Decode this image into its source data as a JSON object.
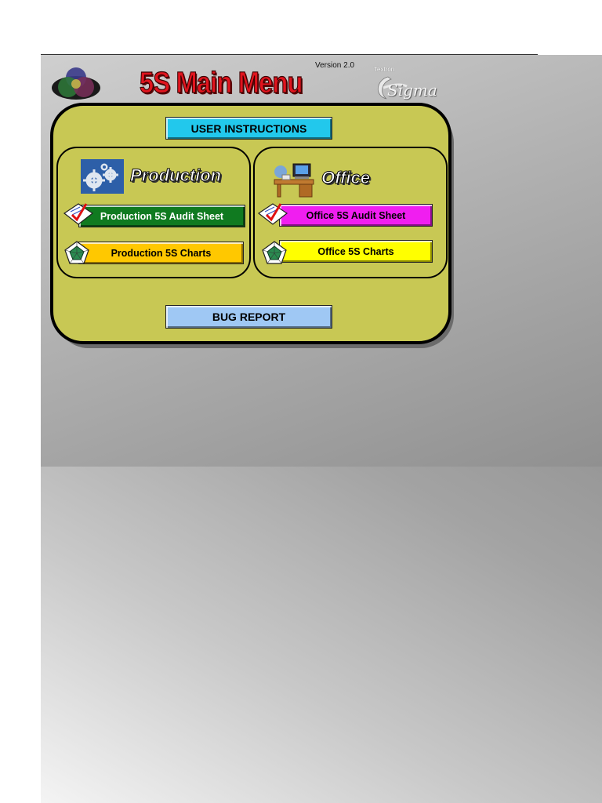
{
  "header": {
    "title": "5S Main Menu",
    "version": "Version 2.0",
    "brand_small": "Textron",
    "brand": "Sigma"
  },
  "menu": {
    "user_instructions": "USER INSTRUCTIONS",
    "bug_report": "BUG REPORT"
  },
  "production": {
    "title": "Production",
    "audit_label": "Production 5S Audit Sheet",
    "charts_label": "Production 5S Charts"
  },
  "office": {
    "title": "Office",
    "audit_label": "Office 5S Audit Sheet",
    "charts_label": "Office 5S Charts"
  },
  "colors": {
    "panel": "#c8c854",
    "user_instructions_button": "#22c8ec",
    "bug_report_button": "#9fc8f4",
    "production_audit_button": "#107a20",
    "production_charts_button": "#ffc800",
    "office_audit_button": "#f01ef0",
    "office_charts_button": "#ffff00",
    "title_text": "#e0141e"
  },
  "icons": [
    "venn-diagram-icon",
    "gears-icon",
    "office-desk-icon",
    "audit-checklist-icon",
    "pentagon-chart-icon"
  ]
}
